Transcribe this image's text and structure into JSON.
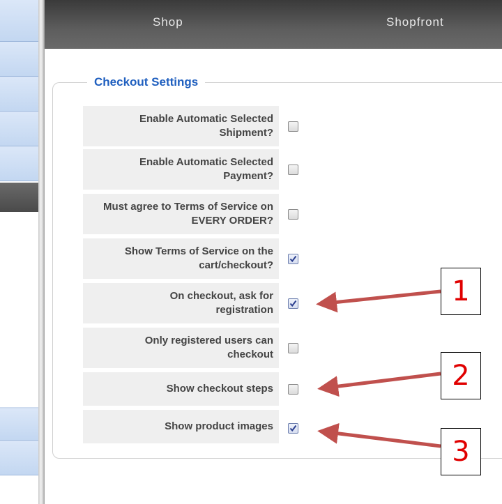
{
  "nav": {
    "shop": "Shop",
    "shopfront": "Shopfront"
  },
  "legend": "Checkout Settings",
  "settings": [
    {
      "label": "Enable Automatic Selected Shipment?",
      "checked": false
    },
    {
      "label": "Enable Automatic Selected Payment?",
      "checked": false
    },
    {
      "label": "Must agree to Terms of Service on EVERY ORDER?",
      "checked": false
    },
    {
      "label": "Show Terms of Service on the cart/checkout?",
      "checked": true
    },
    {
      "label": "On checkout, ask for registration",
      "checked": true
    },
    {
      "label": "Only registered users can checkout",
      "checked": false
    },
    {
      "label": "Show checkout steps",
      "checked": false
    },
    {
      "label": "Show product images",
      "checked": true
    }
  ],
  "annotations": [
    {
      "number": "1"
    },
    {
      "number": "2"
    },
    {
      "number": "3"
    }
  ],
  "colors": {
    "legend": "#1f5fbf",
    "arrow": "#c0504d",
    "annotation_text": "#e00000"
  }
}
